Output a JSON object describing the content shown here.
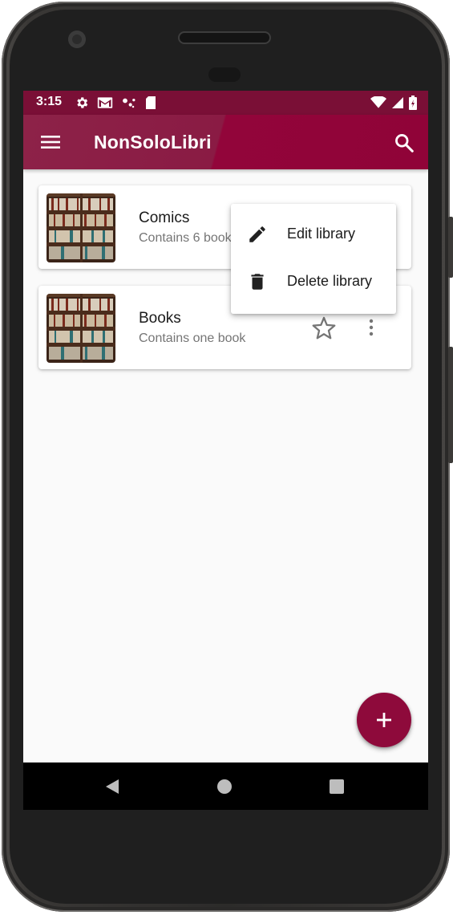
{
  "status_bar": {
    "time": "3:15",
    "left_icons": [
      "gear-icon",
      "gmail-icon",
      "assistant-icon",
      "sd-card-icon"
    ],
    "right_icons": [
      "wifi-icon",
      "signal-icon",
      "battery-icon"
    ]
  },
  "app_bar": {
    "title": "NonSoloLibri",
    "nav_icon": "hamburger-menu-icon",
    "action_icon": "search-icon"
  },
  "libraries": [
    {
      "title": "Comics",
      "subtitle": "Contains 6 books",
      "favorite": false
    },
    {
      "title": "Books",
      "subtitle": "Contains one book",
      "favorite": false
    }
  ],
  "context_menu": {
    "items": [
      {
        "label": "Edit library",
        "icon": "pencil-icon"
      },
      {
        "label": "Delete library",
        "icon": "trash-icon"
      }
    ]
  },
  "fab": {
    "icon": "plus-icon"
  },
  "nav_bar": {
    "icons": [
      "back-icon",
      "home-icon",
      "recents-icon"
    ]
  },
  "colors": {
    "primary": "#8d2248",
    "primary_dark": "#7a0f36",
    "accent": "#8e0a3b",
    "background": "#fafafa"
  }
}
